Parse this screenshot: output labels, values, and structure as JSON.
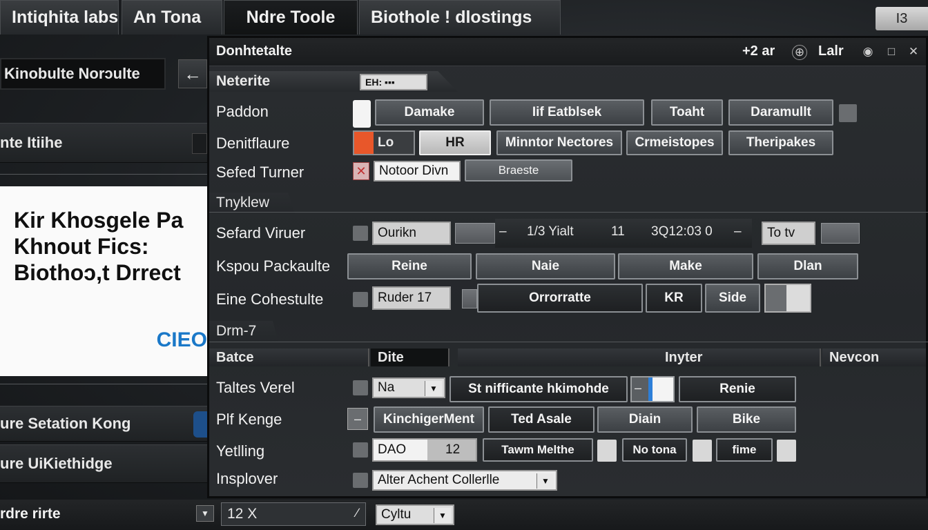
{
  "tabs": [
    "Intiqhita labs",
    "An Tona",
    "Ndre Toole",
    "Biothole ! dlostings"
  ],
  "corner_button": "I3",
  "left_panel": {
    "selected_item": "Kinobulte Norɔulte",
    "row_1": "nte Itiihe",
    "doc_heading": "Kir Khosgele Pa\nKhnout Fics:\nBiothoɔ,t Drrect",
    "doc_logo": "CIEO",
    "row_2": "ure Setation Kong",
    "row_3": "ure UiKiethidge",
    "row_4": "rdre rirte",
    "bottom_field": "12 X",
    "bottom_select": "Cyltu"
  },
  "dialog": {
    "title": "Donhtetalte",
    "zoom": "+2 ar",
    "lang": "Lalr",
    "section_1": "Neterite",
    "section_1_field": "EH: ▪▪▪",
    "padding_label": "Paddon",
    "padding_buttons": [
      "Damake",
      "Iif Eatblsek",
      "Toaht",
      "Daramullt"
    ],
    "dent_label": "Denitflaure",
    "dent_swatch": "Lo",
    "dent_buttons": [
      "HR",
      "Minntor Nectores",
      "Crmeistopes",
      "Theripakes"
    ],
    "seated_label": "Sefed Turner",
    "seated_field": "Notoor Divn",
    "seated_button": "Braeste",
    "section_2": "Tnyklew",
    "safari_label": "Sefard Viruer",
    "safari_field": "Ourikn",
    "slider_left": "1/3 Yialt",
    "slider_mid": "11",
    "slider_right": "3Q12:03 0",
    "to_tv": "To tv",
    "kspou_label": "Kspou Packaulte",
    "kspou_buttons": [
      "Reine",
      "Naie",
      "Make",
      "Dlan"
    ],
    "eine_label": "Eine Cohestulte",
    "eine_field": "Ruder 17",
    "eine_buttons": [
      "Orrorratte",
      "KR",
      "Side"
    ],
    "section_3": "Drm-7",
    "table_headers": [
      "Batce",
      "Dite",
      "Inyter",
      "Nevcon"
    ],
    "taltes_label": "Taltes Verel",
    "taltes_select": "Na",
    "taltes_button": "St nifficante hkimohde",
    "taltes_button2": "Renie",
    "pif_label": "Plf Kenge",
    "pif_buttons": [
      "KinchigerMent",
      "Ted Asale",
      "Diain",
      "Bike"
    ],
    "yetting_label": "Yetlling",
    "yetting_field_a": "DAO",
    "yetting_field_b": "12",
    "yetting_buttons": [
      "Tawm Melthe",
      "No tona",
      "fime"
    ],
    "insp_label": "Insplover",
    "insp_select": "Alter Achent Collerlle"
  },
  "colors": {
    "accent_orange": "#e8572a",
    "checkbox_red": "#c03030",
    "slider_blue": "#2d7fd8",
    "logo_blue": "#1a78c8"
  }
}
